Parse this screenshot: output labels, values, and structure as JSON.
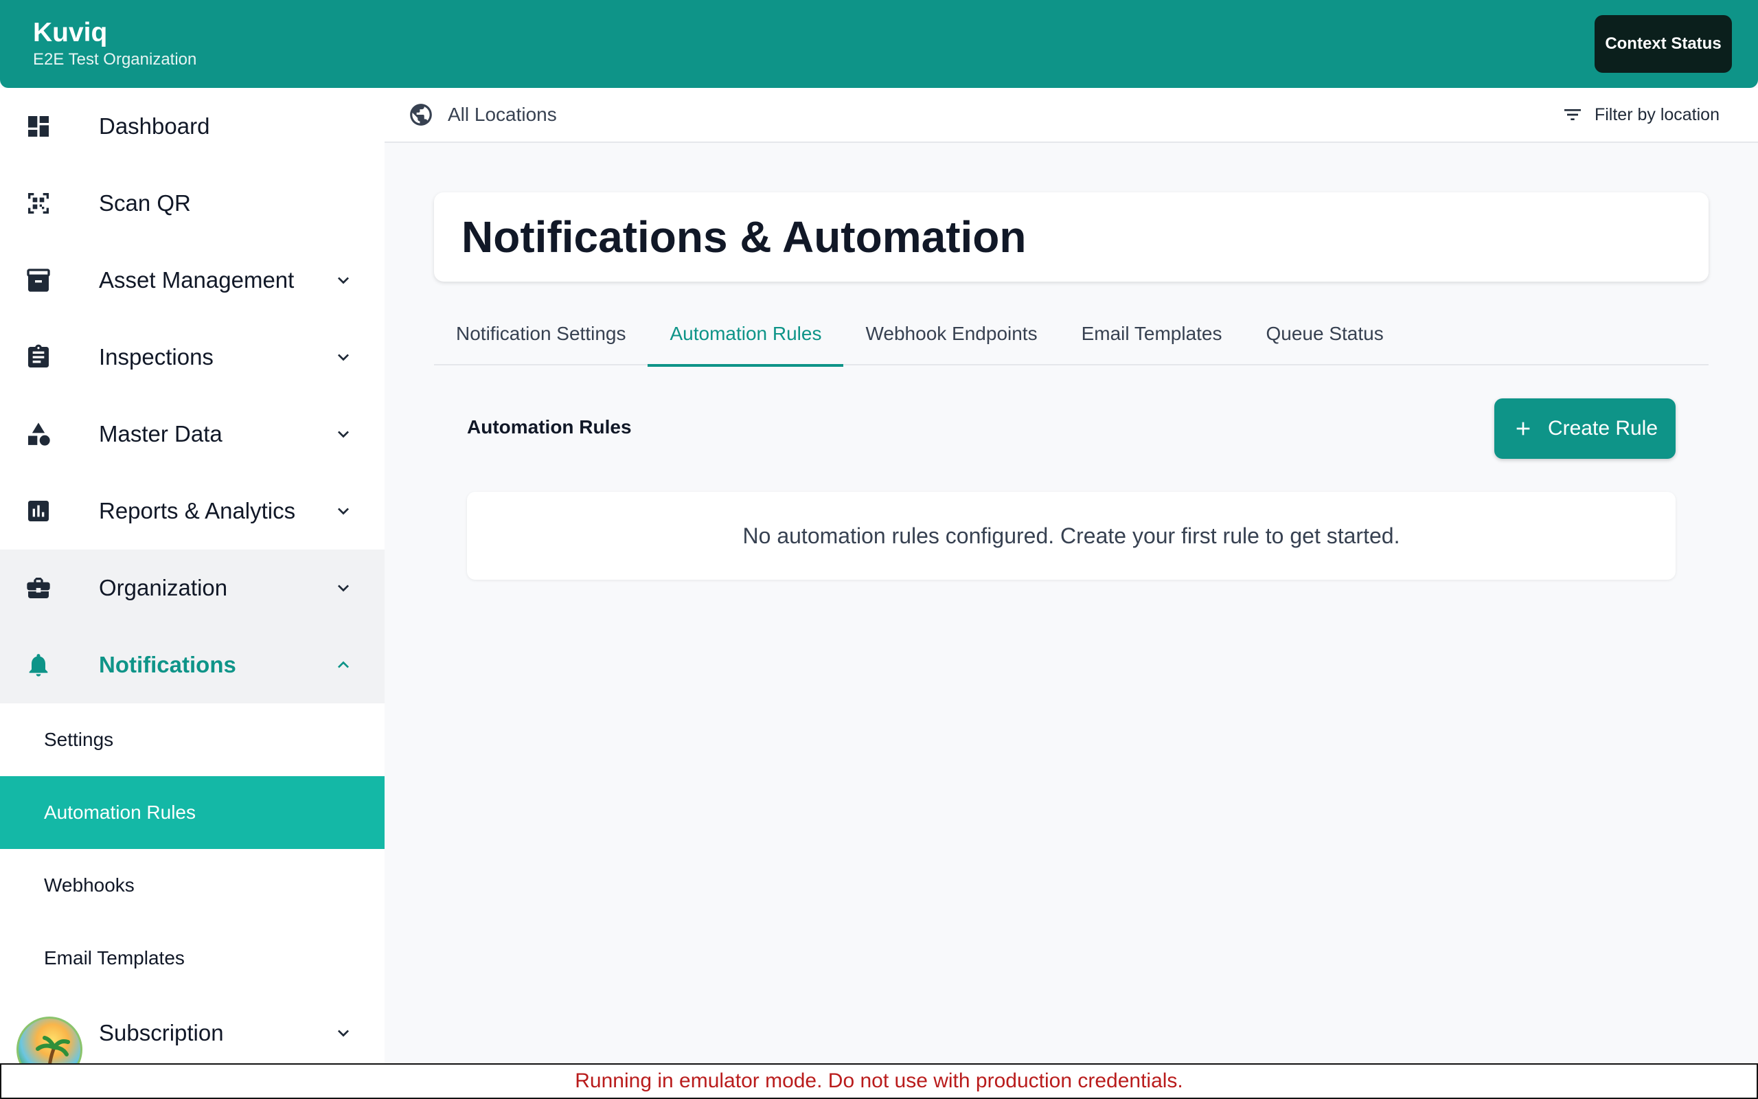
{
  "app": {
    "name": "Kuviq",
    "organization": "E2E Test Organization",
    "context_button": "Context Status"
  },
  "sidebar": {
    "items": [
      {
        "label": "Dashboard",
        "icon": "dashboard-icon"
      },
      {
        "label": "Scan QR",
        "icon": "qr-scan-icon"
      },
      {
        "label": "Asset Management",
        "icon": "archive-icon"
      },
      {
        "label": "Inspections",
        "icon": "clipboard-icon"
      },
      {
        "label": "Master Data",
        "icon": "shapes-icon"
      },
      {
        "label": "Reports & Analytics",
        "icon": "bar-chart-icon"
      },
      {
        "label": "Organization",
        "icon": "briefcase-icon"
      },
      {
        "label": "Notifications",
        "icon": "bell-icon"
      }
    ],
    "sub_items": [
      "Settings",
      "Automation Rules",
      "Webhooks",
      "Email Templates"
    ],
    "last_item": {
      "label": "Subscription",
      "icon": "avatar-icon"
    },
    "active_item": "Notifications",
    "selected_sub_item": "Automation Rules"
  },
  "location_bar": {
    "current": "All Locations",
    "filter_label": "Filter by location"
  },
  "page": {
    "title": "Notifications & Automation",
    "tabs": [
      "Notification Settings",
      "Automation Rules",
      "Webhook Endpoints",
      "Email Templates",
      "Queue Status"
    ],
    "active_tab": "Automation Rules",
    "section_title": "Automation Rules",
    "create_button": "Create Rule",
    "empty_message": "No automation rules configured. Create your first rule to get started."
  },
  "banner": {
    "text": "Running in emulator mode. Do not use with production credentials."
  },
  "colors": {
    "brand": "#0e9488",
    "selected": "#14b8a6",
    "warning_text": "#b91c1c"
  }
}
